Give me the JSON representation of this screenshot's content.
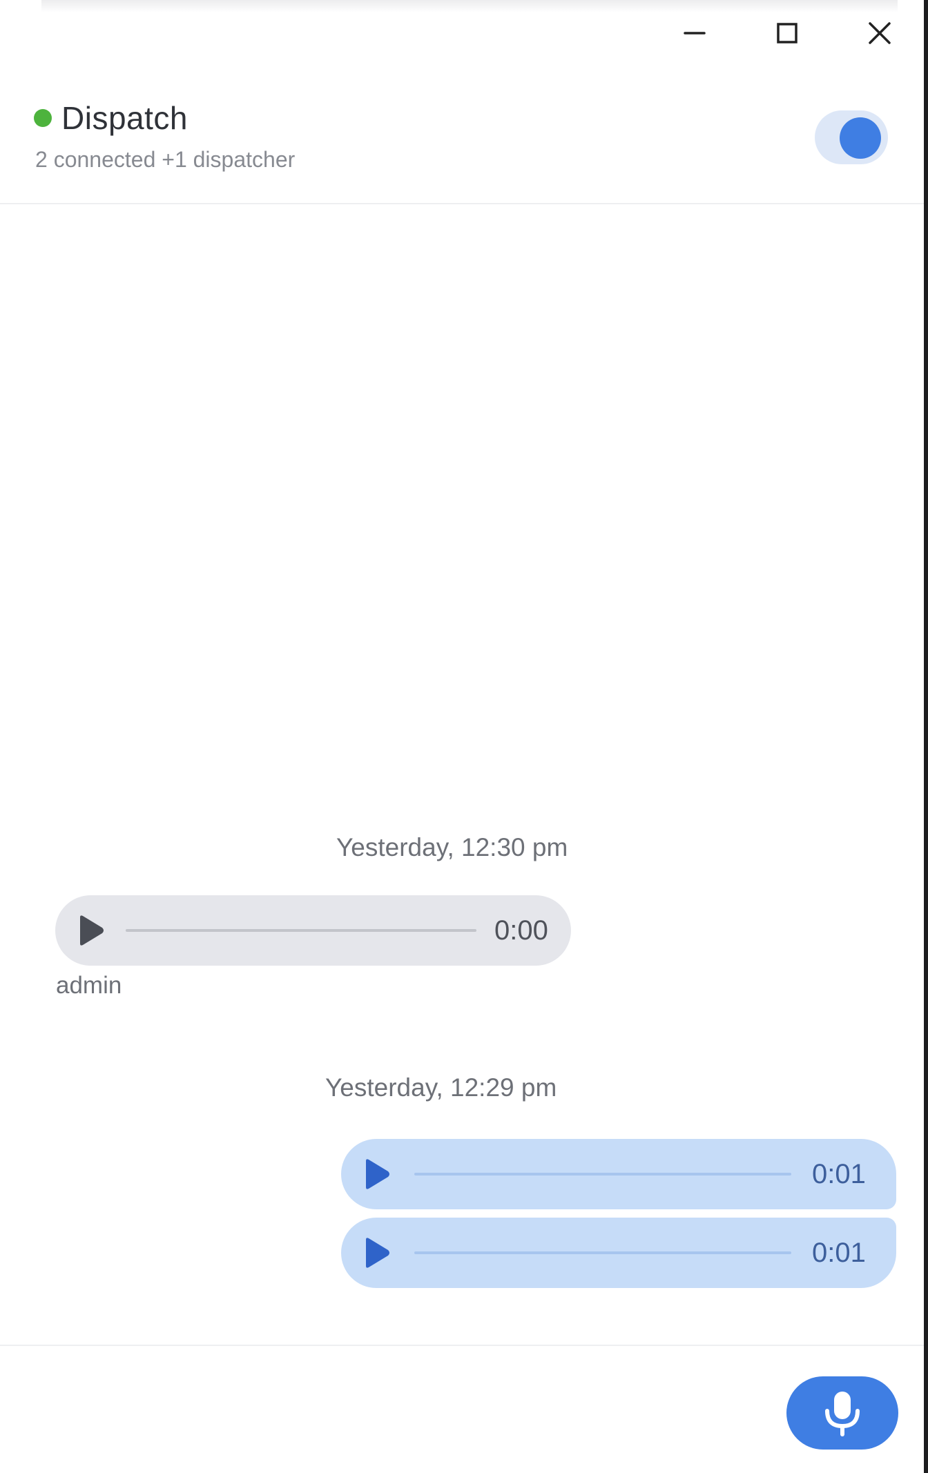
{
  "colors": {
    "online": "#4db33d",
    "accent": "#3f7ee3",
    "incoming_play": "#4a4d55",
    "outgoing_play": "#2f63c9"
  },
  "window_controls": {
    "minimize_icon": "minimize-icon",
    "maximize_icon": "maximize-icon",
    "close_icon": "close-icon"
  },
  "header": {
    "title": "Dispatch",
    "subtitle": "2 connected +1 dispatcher",
    "status": "online",
    "toggle_on": true
  },
  "messages": [
    {
      "timestamp": "Yesterday, 12:30 pm",
      "direction": "incoming",
      "sender": "admin",
      "clips": [
        {
          "duration": "0:00",
          "progress": 0
        }
      ]
    },
    {
      "timestamp": "Yesterday, 12:29 pm",
      "direction": "outgoing",
      "clips": [
        {
          "duration": "0:01",
          "progress": 0
        },
        {
          "duration": "0:01",
          "progress": 0
        }
      ]
    }
  ],
  "footer": {
    "record_icon": "microphone-icon"
  }
}
